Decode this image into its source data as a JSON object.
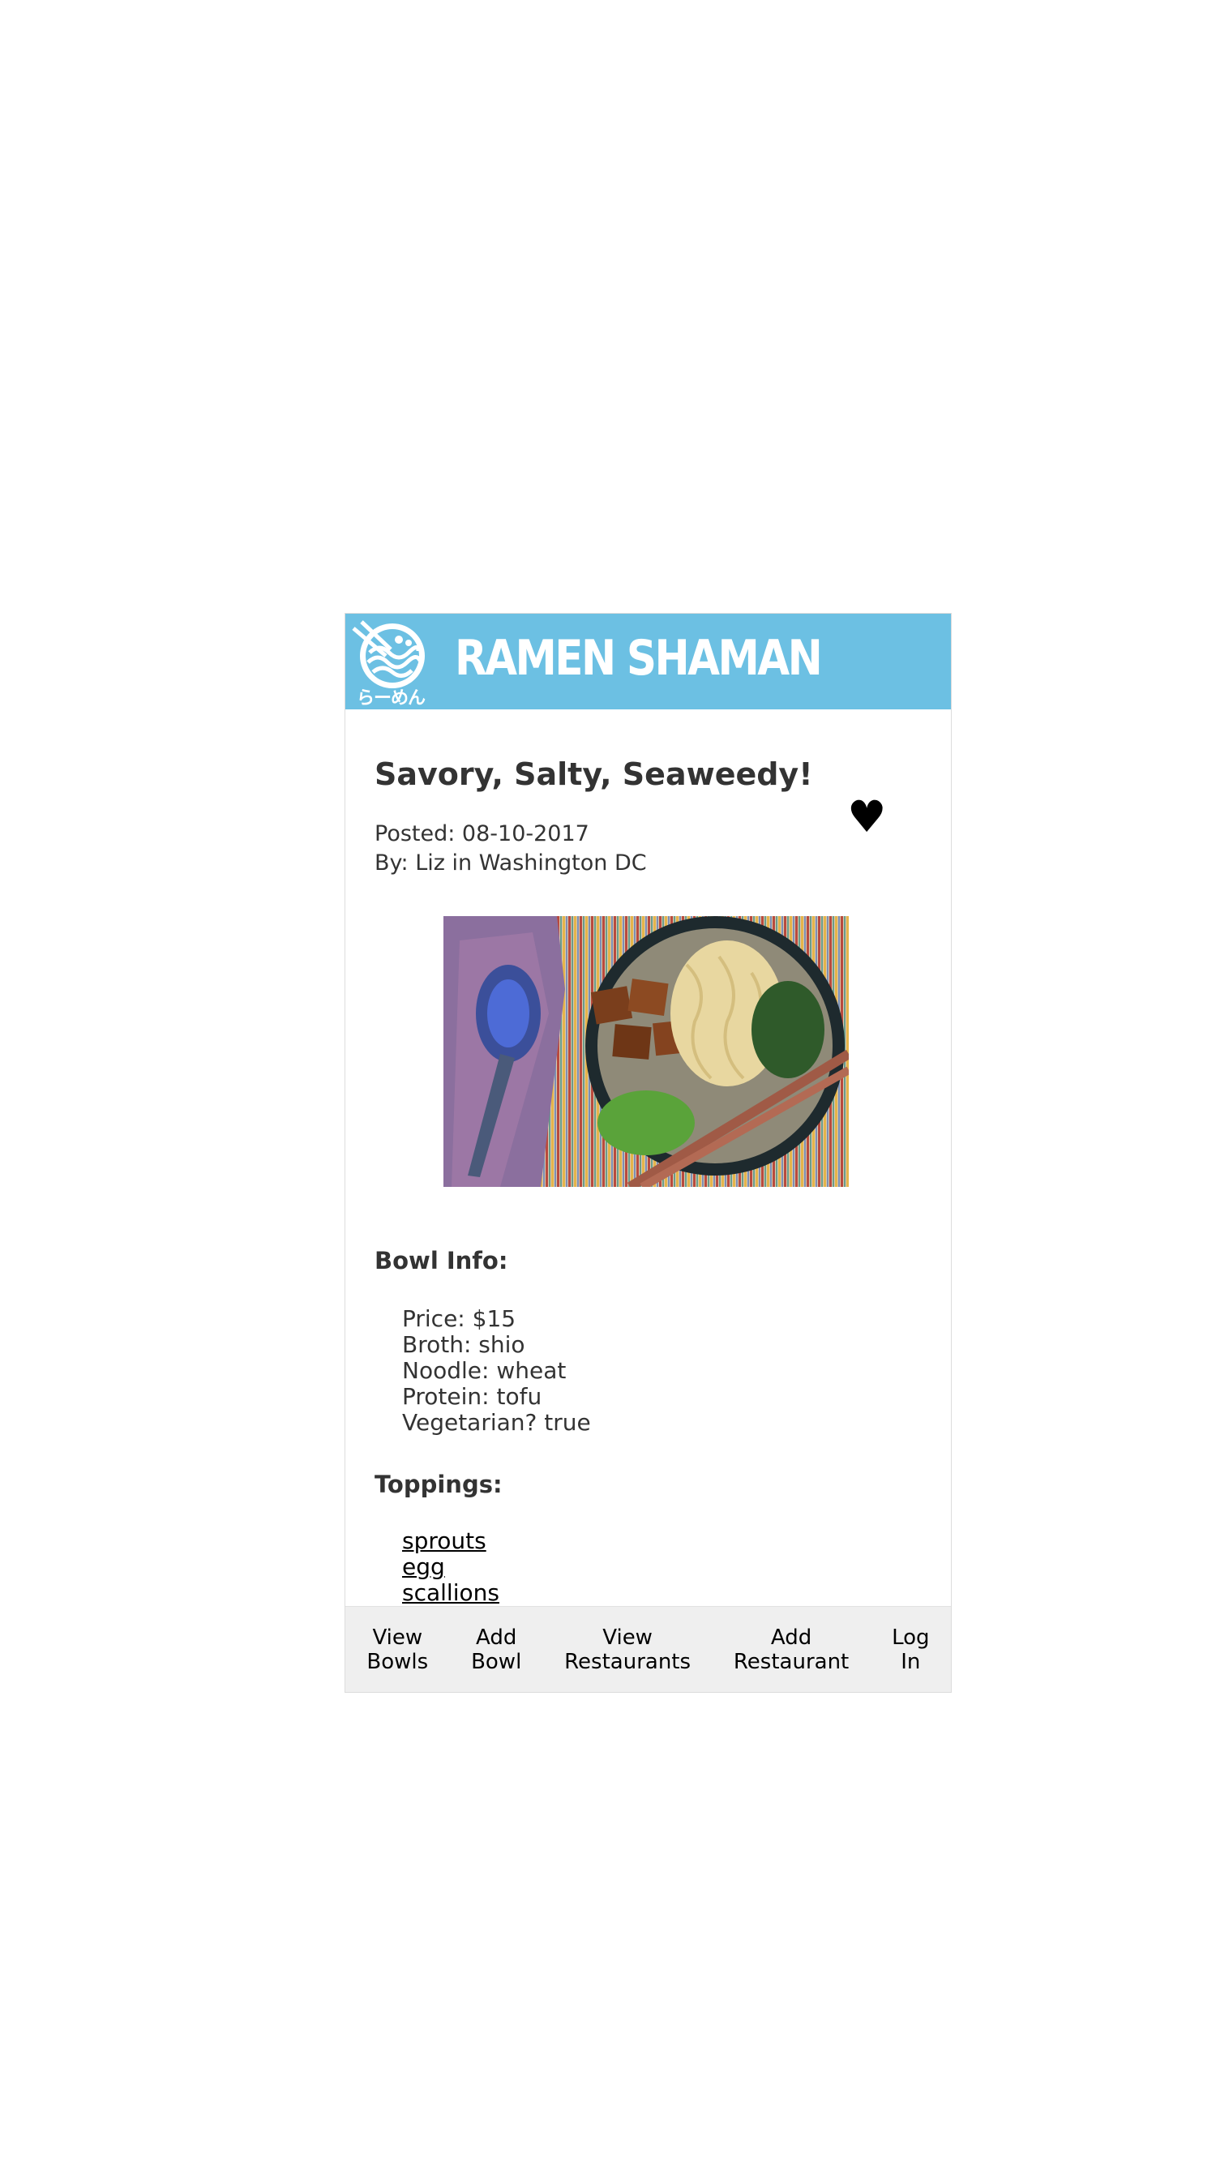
{
  "header": {
    "app_title": "RAMEN SHAMAN",
    "logo_icon": "ramen-bowl-logo-icon",
    "logo_text": "らーめん",
    "background_color": "#6cc0e3"
  },
  "post": {
    "title": "Savory, Salty, Seaweedy!",
    "favorite_icon": "heart-icon",
    "favorite_glyph": "♥",
    "posted": "Posted: 08-10-2017",
    "by": "By: Liz in Washington DC"
  },
  "bowl_info": {
    "heading": "Bowl Info:",
    "price": "Price: $15",
    "broth": "Broth: shio",
    "noodle": "Noodle: wheat",
    "protein": "Protein: tofu",
    "vegetarian": "Vegetarian? true"
  },
  "toppings": {
    "heading": "Toppings:",
    "items": [
      "sprouts",
      "egg",
      "scallions"
    ]
  },
  "nav": {
    "items": [
      {
        "line1": "View",
        "line2": "Bowls"
      },
      {
        "line1": "Add",
        "line2": "Bowl"
      },
      {
        "line1": "View",
        "line2": "Restaurants"
      },
      {
        "line1": "Add",
        "line2": "Restaurant"
      },
      {
        "line1": "Log",
        "line2": "In"
      }
    ]
  }
}
